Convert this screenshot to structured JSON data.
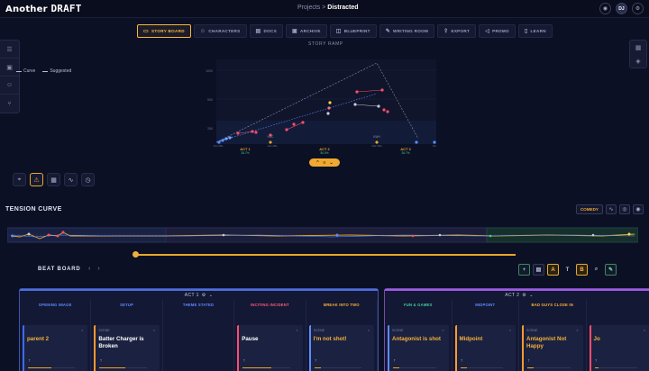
{
  "app": {
    "logo_a": "Another",
    "logo_b": "DRAFT"
  },
  "breadcrumb": {
    "parent": "Projects",
    "sep": ">",
    "current": "Distracted"
  },
  "user": {
    "initials": "DJ"
  },
  "tabs": [
    {
      "label": "STORY BOARD",
      "icon": "monitor-icon",
      "active": true
    },
    {
      "label": "CHARACTERS",
      "icon": "users-icon",
      "active": false
    },
    {
      "label": "DOCS",
      "icon": "doc-icon",
      "active": false
    },
    {
      "label": "ARCHIVE",
      "icon": "archive-icon",
      "active": false
    },
    {
      "label": "BLUEPRINT",
      "icon": "blueprint-icon",
      "active": false
    },
    {
      "label": "WRITING ROOM",
      "icon": "pen-icon",
      "active": false
    },
    {
      "label": "EXPORT",
      "icon": "export-icon",
      "active": false
    },
    {
      "label": "PROMO",
      "icon": "megaphone-icon",
      "active": false
    },
    {
      "label": "LEARN",
      "icon": "book-icon",
      "active": false
    }
  ],
  "story_ramp": {
    "title": "STORY RAMP",
    "legend": {
      "curve": "Curve",
      "suggested": "Suggested"
    },
    "acts": [
      {
        "label": "ACT 1",
        "pct": "26.7%"
      },
      {
        "label": "ACT 2",
        "pct": "50.0%"
      },
      {
        "label": "ACT 3",
        "pct": "26.7%"
      }
    ],
    "markers": [
      {
        "label": "VOC"
      },
      {
        "label": "KWH"
      }
    ],
    "axis_ticks": [
      "Oct 28a",
      "Jan 28a",
      "Mar 28a",
      "Feb 28a",
      "0m"
    ],
    "y_ticks": [
      "1000",
      "500",
      "250",
      "100"
    ]
  },
  "tension": {
    "title": "TENSION CURVE",
    "genre": "COMEDY"
  },
  "beat_board": {
    "title": "BEAT BOARD",
    "tool_letters": [
      "A",
      "T",
      "B"
    ],
    "acts": [
      {
        "label": "ACT 1",
        "columns": [
          {
            "title": "OPENING IMAGE",
            "color": "#5b8cff",
            "card": {
              "label": "",
              "title": "parent 2",
              "title_color": "#f3b13b",
              "bar": "#3e6bff",
              "progress": 0.5
            }
          },
          {
            "title": "SETUP",
            "color": "#5b8cff",
            "card": {
              "label": "SCENE",
              "title": "Batter Charger is Broken",
              "title_color": "#ffffff",
              "bar": "#ff9a2e",
              "progress": 0.55
            }
          },
          {
            "title": "THEME STATED",
            "color": "#5b8cff",
            "card": null
          },
          {
            "title": "INCITING INCIDENT",
            "color": "#ff5b7a",
            "card": {
              "label": "",
              "title": "Pause",
              "title_color": "#ffffff",
              "bar": "#ff4d6d",
              "progress": 0.6
            }
          },
          {
            "title": "BREAK INTO TWO",
            "color": "#ffb43a",
            "card": {
              "label": "SCENE",
              "title": "I'm not shot!",
              "title_color": "#f3b13b",
              "bar": "#5b8cff",
              "progress": 0.15
            }
          }
        ]
      },
      {
        "label": "ACT 2",
        "columns": [
          {
            "title": "FUN & GAMES",
            "color": "#3fd1a0",
            "card": {
              "label": "SCENE",
              "title": "Antagonist is shot",
              "title_color": "#f3b13b",
              "bar": "#5b8cff",
              "progress": 0.15
            }
          },
          {
            "title": "MIDPOINT",
            "color": "#5b8cff",
            "card": {
              "label": "",
              "title": "Midpoint",
              "title_color": "#f3b13b",
              "bar": "#ff9a2e",
              "progress": 0.15
            }
          },
          {
            "title": "BAD GUYS CLOSE IN",
            "color": "#ffb43a",
            "card": {
              "label": "SCENE",
              "title": "Antagonist Not Happy",
              "title_color": "#f3b13b",
              "bar": "#ff9a2e",
              "progress": 0.15
            }
          },
          {
            "title": "",
            "color": "#ffb43a",
            "card": {
              "label": "",
              "title": "Jo",
              "title_color": "#f3b13b",
              "bar": "#ff4d6d",
              "progress": 0.1
            }
          }
        ]
      }
    ]
  }
}
